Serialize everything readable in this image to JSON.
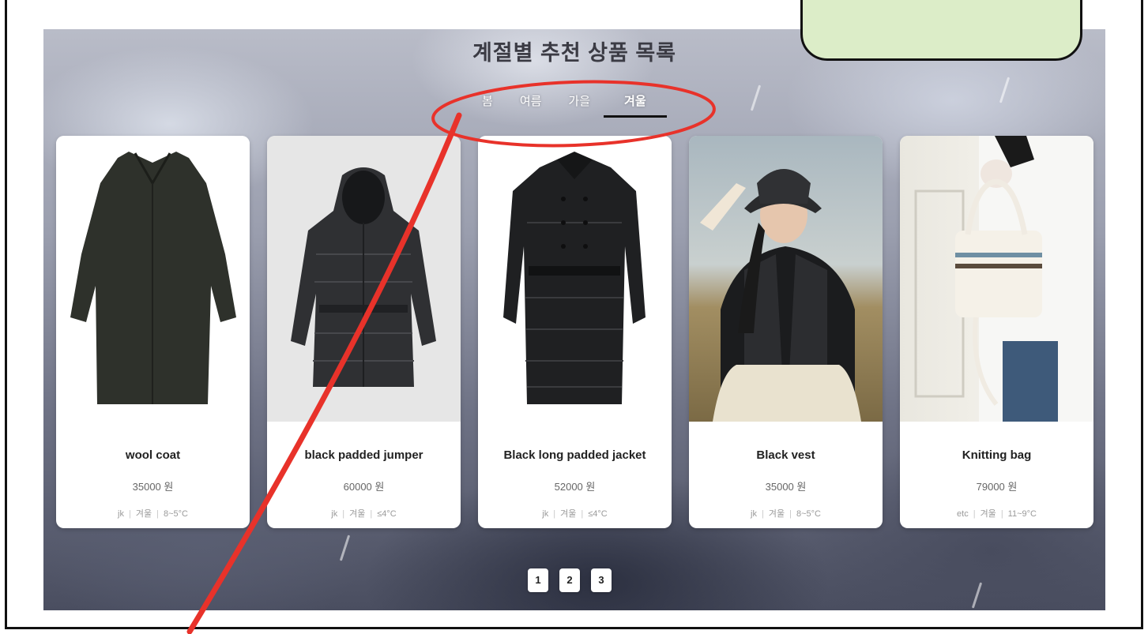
{
  "page": {
    "title": "계절별 추천 상품 목록"
  },
  "tabs": [
    {
      "label": "봄",
      "active": false
    },
    {
      "label": "여름",
      "active": false
    },
    {
      "label": "가을",
      "active": false
    },
    {
      "label": "겨울",
      "active": true
    }
  ],
  "products": [
    {
      "name": "wool coat",
      "price": "35000 원",
      "category": "jk",
      "season": "겨울",
      "temp": "8~5°C",
      "image_icon": "wool-coat-image"
    },
    {
      "name": "black padded jumper",
      "price": "60000 원",
      "category": "jk",
      "season": "겨울",
      "temp": "≤4°C",
      "image_icon": "padded-jumper-image"
    },
    {
      "name": "Black long padded jacket",
      "price": "52000 원",
      "category": "jk",
      "season": "겨울",
      "temp": "≤4°C",
      "image_icon": "long-padded-jacket-image"
    },
    {
      "name": "Black vest",
      "price": "35000 원",
      "category": "jk",
      "season": "겨울",
      "temp": "8~5°C",
      "image_icon": "vest-photo-image"
    },
    {
      "name": "Knitting bag",
      "price": "79000 원",
      "category": "etc",
      "season": "겨울",
      "temp": "11~9°C",
      "image_icon": "knitting-bag-photo-image"
    }
  ],
  "pagination": [
    "1",
    "2",
    "3"
  ],
  "callout": {
    "label": "",
    "background": "#dcedc8"
  },
  "colors": {
    "annotation_red": "#e8322a",
    "active_tab_underline": "#111111"
  }
}
